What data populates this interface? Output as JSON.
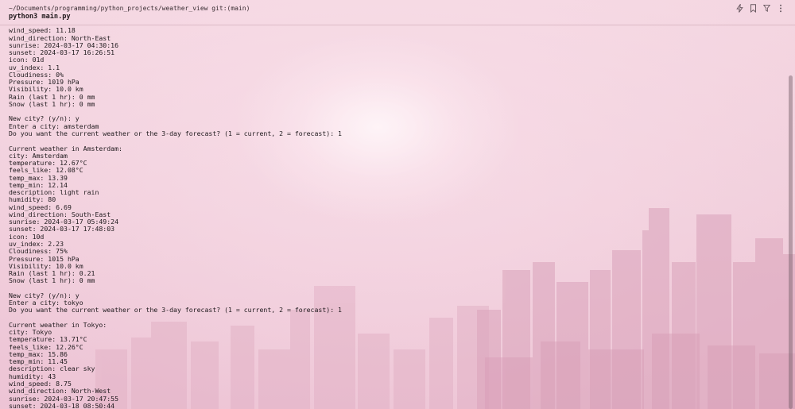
{
  "header": {
    "path": "~/Documents/programming/python_projects/weather_view git:(main)",
    "command": "python3 main.py"
  },
  "toolbar": {
    "icons": [
      "lightning-icon",
      "bookmark-icon",
      "filter-icon",
      "more-vertical-icon"
    ]
  },
  "terminal": {
    "lines": [
      "",
      "wind_speed: 11.18",
      "wind_direction: North-East",
      "sunrise: 2024-03-17 04:30:16",
      "sunset: 2024-03-17 16:26:51",
      "icon: 01d",
      "uv_index: 1.1",
      "Cloudiness: 0%",
      "Pressure: 1019 hPa",
      "Visibility: 10.0 km",
      "Rain (last 1 hr): 0 mm",
      "Snow (last 1 hr): 0 mm",
      "",
      "New city? (y/n): y",
      "Enter a city: amsterdam",
      "Do you want the current weather or the 3-day forecast? (1 = current, 2 = forecast): 1",
      "",
      "Current weather in Amsterdam:",
      "city: Amsterdam",
      "temperature: 12.67°C",
      "feels_like: 12.08°C",
      "temp_max: 13.39",
      "temp_min: 12.14",
      "description: light rain",
      "humidity: 80",
      "wind_speed: 6.69",
      "wind_direction: South-East",
      "sunrise: 2024-03-17 05:49:24",
      "sunset: 2024-03-17 17:48:03",
      "icon: 10d",
      "uv_index: 2.23",
      "Cloudiness: 75%",
      "Pressure: 1015 hPa",
      "Visibility: 10.0 km",
      "Rain (last 1 hr): 0.21",
      "Snow (last 1 hr): 0 mm",
      "",
      "New city? (y/n): y",
      "Enter a city: tokyo",
      "Do you want the current weather or the 3-day forecast? (1 = current, 2 = forecast): 1",
      "",
      "Current weather in Tokyo:",
      "city: Tokyo",
      "temperature: 13.71°C",
      "feels_like: 12.26°C",
      "temp_max: 15.86",
      "temp_min: 11.45",
      "description: clear sky",
      "humidity: 43",
      "wind_speed: 8.75",
      "wind_direction: North-West",
      "sunrise: 2024-03-17 20:47:55",
      "sunset: 2024-03-18 08:50:44"
    ]
  }
}
